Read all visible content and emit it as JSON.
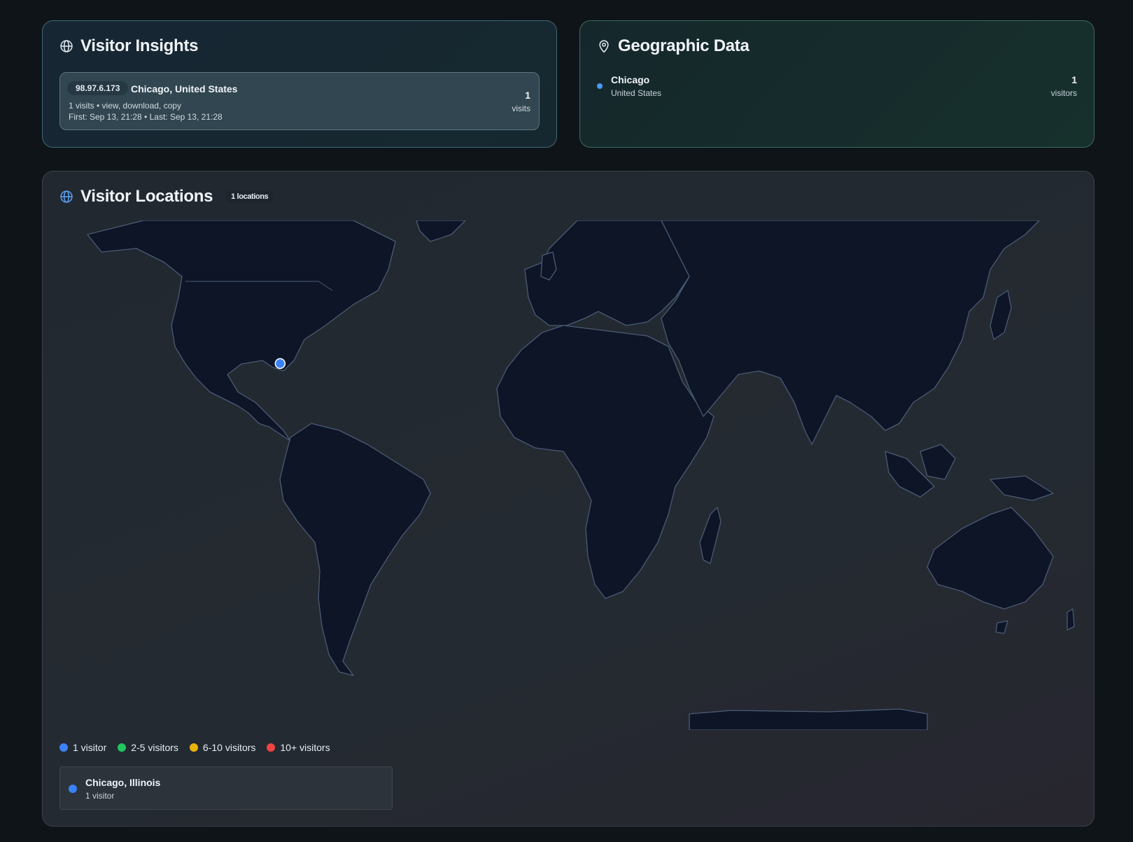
{
  "insights": {
    "title": "Visitor Insights",
    "icon": "globe-icon",
    "visitor": {
      "ip": "98.97.6.173",
      "location": "Chicago, United States",
      "meta": "1 visits • view, download, copy",
      "times": "First: Sep 13, 21:28 • Last: Sep 13, 21:28",
      "count": "1",
      "count_label": "visits"
    }
  },
  "geo": {
    "title": "Geographic Data",
    "icon": "map-pin-icon",
    "city": "Chicago",
    "country": "United States",
    "count": "1",
    "count_label": "visitors",
    "dot_color": "#4a9af5"
  },
  "locations": {
    "title": "Visitor Locations",
    "icon": "globe-icon",
    "badge": "1 locations",
    "legend": [
      {
        "label": "1 visitor",
        "color": "#3b82f6"
      },
      {
        "label": "2-5 visitors",
        "color": "#22c55e"
      },
      {
        "label": "6-10 visitors",
        "color": "#eab308"
      },
      {
        "label": "10+ visitors",
        "color": "#ef4444"
      }
    ],
    "list": [
      {
        "name": "Chicago, Illinois",
        "sub": "1 visitor",
        "color": "#3b82f6"
      }
    ],
    "markers": [
      {
        "name": "Chicago",
        "lat": 41.88,
        "lon": -87.63,
        "color": "#3b82f6"
      }
    ]
  }
}
